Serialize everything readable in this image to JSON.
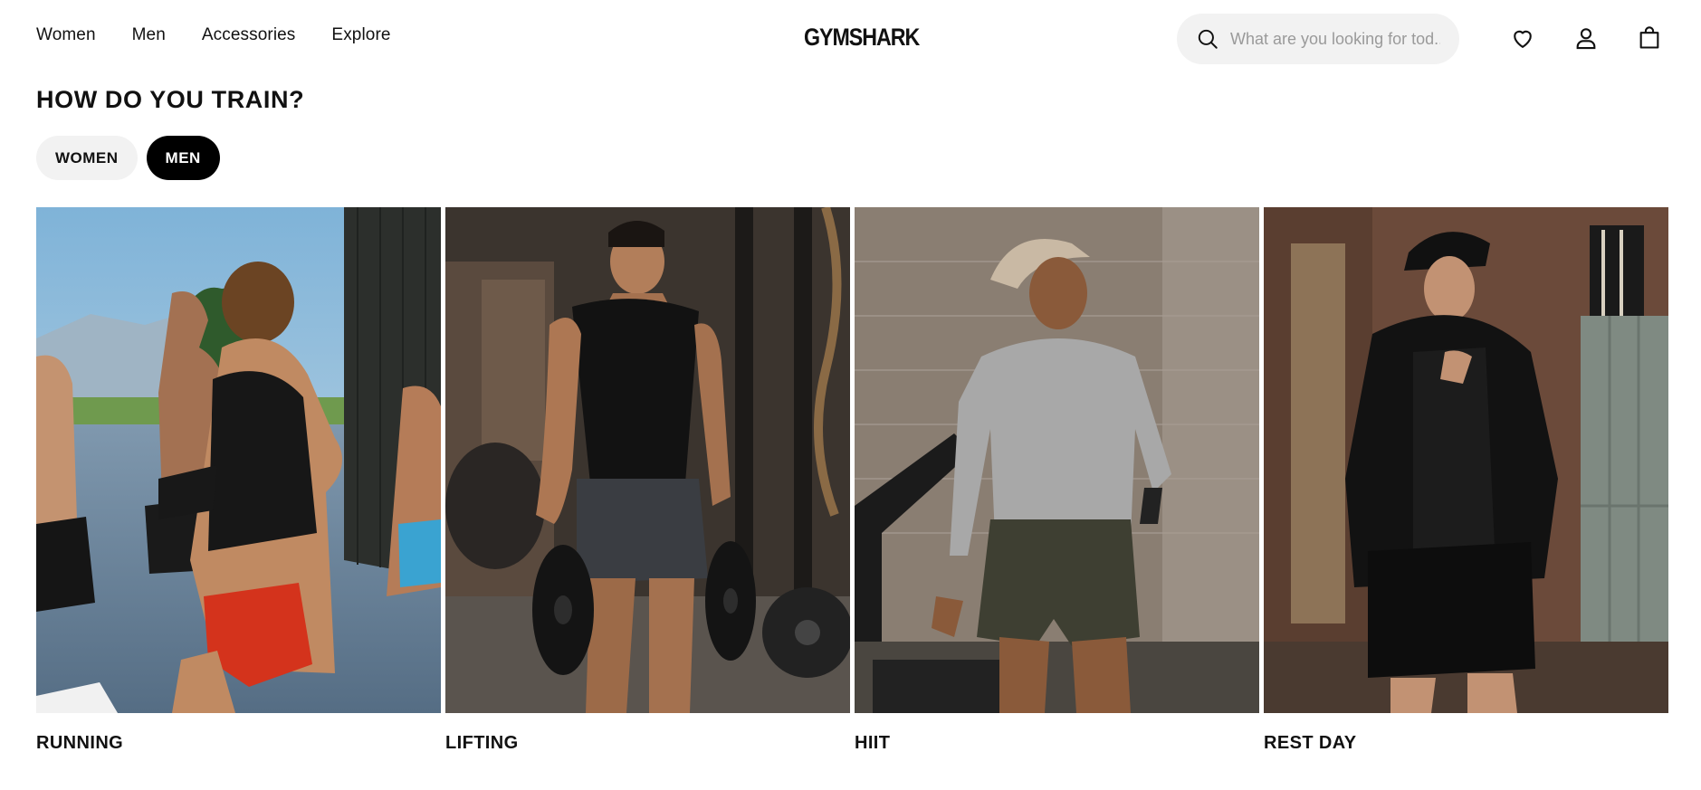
{
  "header": {
    "nav": [
      "Women",
      "Men",
      "Accessories",
      "Explore"
    ],
    "logo": "GYMSHARK",
    "search_placeholder": "What are you looking for tod...",
    "icons": [
      "search-icon",
      "heart-icon",
      "account-icon",
      "bag-icon"
    ]
  },
  "section": {
    "title": "HOW DO YOU TRAIN?",
    "toggle": {
      "women": "WOMEN",
      "men": "MEN",
      "selected": "MEN"
    },
    "cards": [
      {
        "label": "RUNNING"
      },
      {
        "label": "LIFTING"
      },
      {
        "label": "HIIT"
      },
      {
        "label": "REST DAY"
      }
    ]
  },
  "colors": {
    "text": "#111111",
    "pill_active": "#000000",
    "pill_inactive": "#f2f2f2",
    "search_bg": "#f2f2f2"
  }
}
